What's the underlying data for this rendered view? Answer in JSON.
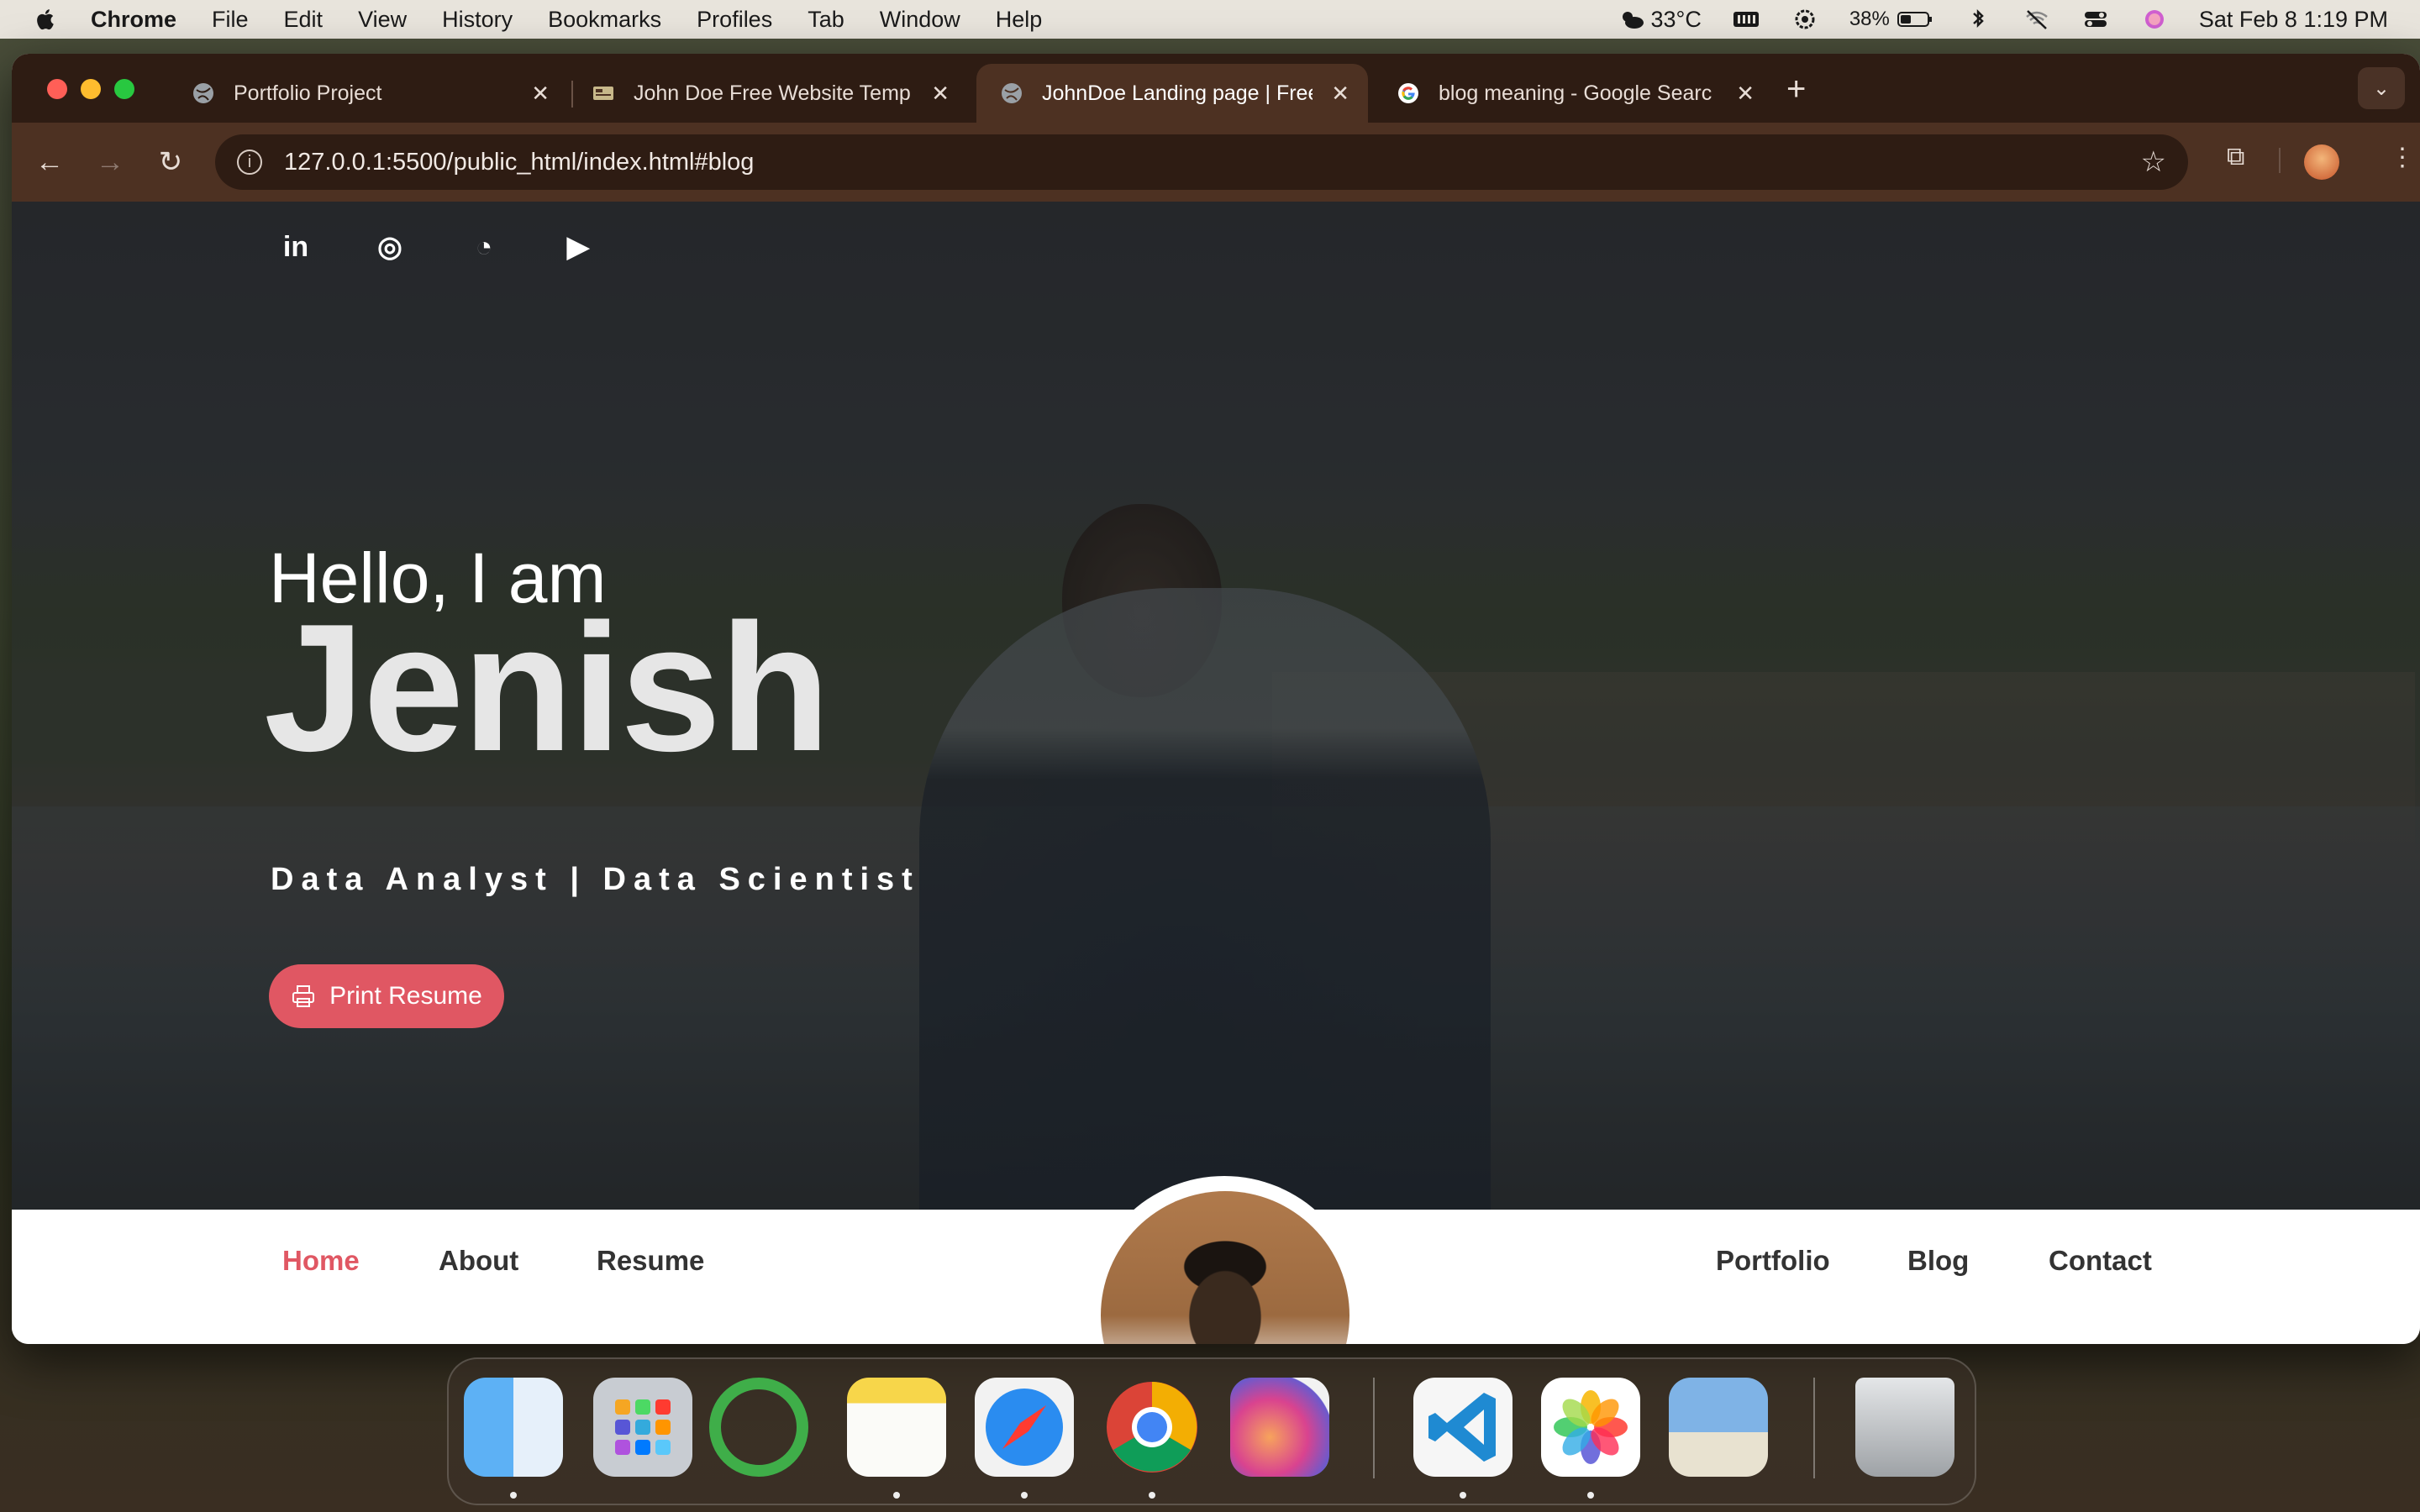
{
  "menubar": {
    "app_name": "Chrome",
    "items": [
      "File",
      "Edit",
      "View",
      "History",
      "Bookmarks",
      "Profiles",
      "Tab",
      "Window",
      "Help"
    ],
    "weather": "33°C",
    "battery": "38%",
    "datetime": "Sat Feb 8  1:19 PM"
  },
  "tabs": [
    {
      "title": "Portfolio Project",
      "icon": "globe-icon",
      "active": false
    },
    {
      "title": "John Doe Free Website Templ",
      "icon": "template-icon",
      "active": false
    },
    {
      "title": "JohnDoe Landing page | Free",
      "icon": "globe-icon",
      "active": true
    },
    {
      "title": "blog meaning - Google Searc",
      "icon": "google-icon",
      "active": false
    }
  ],
  "address_bar": {
    "url": "127.0.0.1:5500/public_html/index.html#blog"
  },
  "hero": {
    "socials": [
      {
        "name": "linkedin-icon",
        "glyph": "in"
      },
      {
        "name": "instagram-icon",
        "glyph": "◎"
      },
      {
        "name": "github-icon",
        "glyph": "◔"
      },
      {
        "name": "youtube-icon",
        "glyph": "▶"
      }
    ],
    "greeting": "Hello, I am",
    "name": "Jenish",
    "role": "Data Analyst | Data Scientist",
    "button_label": "Print Resume"
  },
  "nav": {
    "left": [
      "Home",
      "About",
      "Resume"
    ],
    "right": [
      "Portfolio",
      "Blog",
      "Contact"
    ],
    "active": "Home"
  },
  "dock": {
    "apps": [
      "Finder",
      "Launchpad",
      "Activity",
      "Notes",
      "Safari",
      "Chrome",
      "Pixelmator",
      "VS Code",
      "Photos",
      "Preview",
      "Trash"
    ]
  },
  "colors": {
    "accent": "#e05763",
    "tab_bg": "#2e1c13",
    "toolbar_bg": "#4d3122"
  }
}
